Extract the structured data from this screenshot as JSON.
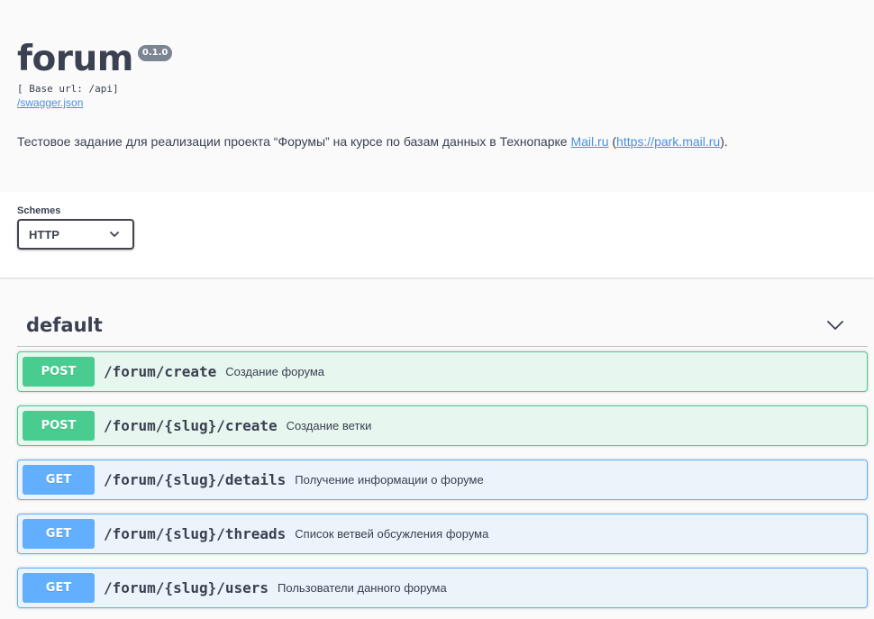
{
  "info": {
    "title": "forum",
    "version": "0.1.0",
    "base_url": "[ Base url: /api]",
    "spec_link": "/swagger.json",
    "description_before": "Тестовое задание для реализации проекта “Форумы” на курсе по базам данных в Технопарке ",
    "description_link1": "Mail.ru",
    "description_mid": " (",
    "description_link2": "https://park.mail.ru",
    "description_after": ")."
  },
  "schemes": {
    "label": "Schemes",
    "selected": "HTTP"
  },
  "tag": {
    "name": "default",
    "icon": "chevron-down-icon"
  },
  "operations": [
    {
      "method": "POST",
      "path": "/forum/create",
      "summary": "Создание форума"
    },
    {
      "method": "POST",
      "path": "/forum/{slug}/create",
      "summary": "Создание ветки"
    },
    {
      "method": "GET",
      "path": "/forum/{slug}/details",
      "summary": "Получение информации о форуме"
    },
    {
      "method": "GET",
      "path": "/forum/{slug}/threads",
      "summary": "Список ветвей обсужления форума"
    },
    {
      "method": "GET",
      "path": "/forum/{slug}/users",
      "summary": "Пользователи данного форума"
    }
  ],
  "colors": {
    "post": "#49cc90",
    "get": "#61affe",
    "link": "#4990e2",
    "text": "#3b4151"
  }
}
